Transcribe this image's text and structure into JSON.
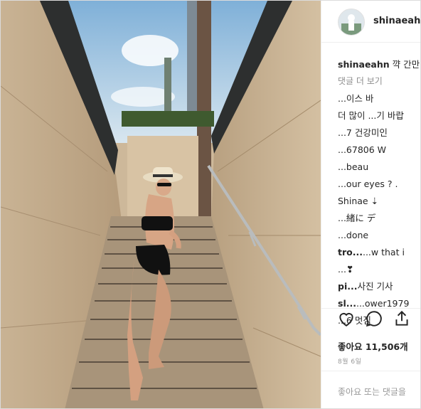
{
  "header": {
    "username": "shinaeahn"
  },
  "caption": {
    "username": "shinaeahn",
    "text": "꺅 간만이"
  },
  "view_more_comments": "댓글 더 보기",
  "comments": [
    {
      "user": "",
      "text": "...이스 바"
    },
    {
      "user": "",
      "text": "더 많이 ...기 바랍"
    },
    {
      "user": "",
      "text": "...7 건강미인"
    },
    {
      "user": "",
      "text": "...67806 W"
    },
    {
      "user": "",
      "text": "...beau"
    },
    {
      "user": "",
      "text": "...our eyes ? ."
    },
    {
      "user": "",
      "text": "Shinae ⇣"
    },
    {
      "user": "",
      "text": "...緒に デ"
    },
    {
      "user": "",
      "text": "...done"
    },
    {
      "user": "tro...",
      "text": "...w that i"
    },
    {
      "user": "",
      "text": "...❣"
    },
    {
      "user": "pi...",
      "text": "사진 기사"
    },
    {
      "user": "sl...",
      "text": "...ower1979"
    },
    {
      "user": "",
      "text": "...6 멋짐"
    }
  ],
  "likes": "좋아요 11,506개",
  "date": "8월 6일",
  "add_comment_placeholder": "좋아요 또는 댓글을",
  "icons": [
    "heart-icon",
    "comment-icon",
    "share-icon"
  ]
}
